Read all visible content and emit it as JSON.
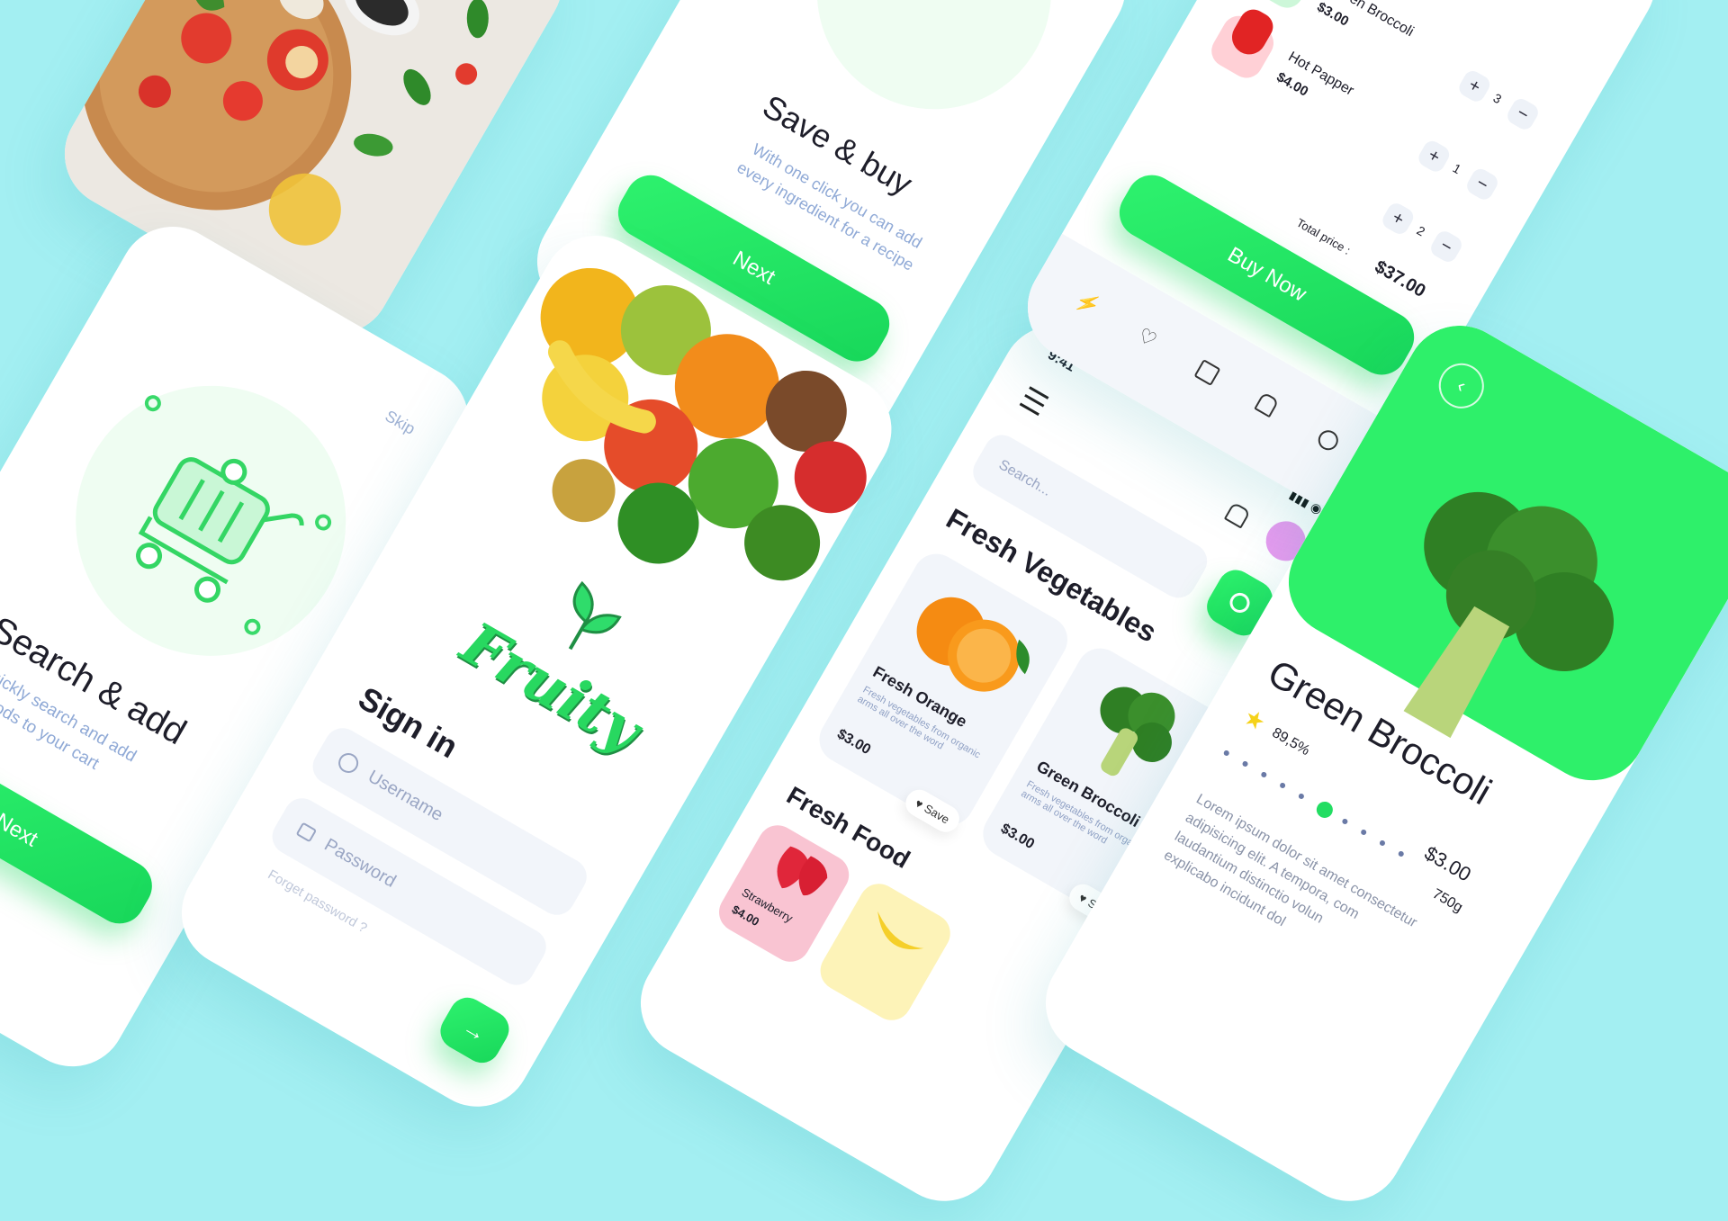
{
  "onboard_search": {
    "skip_label": "Skip",
    "title": "Search & add",
    "subtitle_line1": "Quickly search and add",
    "subtitle_line2": "foods to your cart",
    "next_label": "Next"
  },
  "onboard_save": {
    "title": "Save & buy",
    "subtitle_line1": "With one click you can add",
    "subtitle_line2": "every ingredient for a recipe",
    "next_label": "Next"
  },
  "signin": {
    "logo_text": "Fruity",
    "title": "Sign in",
    "username_placeholder": "Username",
    "password_placeholder": "Password",
    "forgot_label": "Forget password ?"
  },
  "home": {
    "time": "9:41",
    "search_placeholder": "Search...",
    "section_vegetables": "Fresh Vegetables",
    "section_food": "Fresh Food",
    "save_label": "Save",
    "products": [
      {
        "name": "Fresh Orange",
        "desc": "Fresh vegetables from organic arms all over the word",
        "price": "$3.00"
      },
      {
        "name": "Green Broccoli",
        "desc": "Fresh vegetables from organic arms all over the word",
        "price": "$3.00"
      }
    ],
    "food": [
      {
        "name": "Strawberry",
        "price": "$4.00"
      }
    ]
  },
  "cart": {
    "items": [
      {
        "name": "Green Broccoli",
        "price": "$3.00",
        "qty": "3"
      },
      {
        "name": "Hot Papper",
        "price": "$4.00",
        "qty": "1"
      },
      {
        "name": "",
        "price": "",
        "qty": "2"
      }
    ],
    "total_label": "Total price :",
    "total_value": "$37.00",
    "buy_label": "Buy Now",
    "nav_icons": [
      "bolt-icon",
      "heart-icon",
      "bag-icon",
      "bell-icon",
      "user-icon"
    ]
  },
  "detail": {
    "title": "Green Broccoli",
    "rating": "89,5%",
    "price": "$3.00",
    "weight": "750g",
    "desc_line1": "Lorem ipsum dolor sit amet consectetur",
    "desc_line2": "adipisicing elit. A tempora, com",
    "desc_line3": "laudantium distinctio volun",
    "desc_line4": "explicabo incidunt dol"
  },
  "colors": {
    "background": "#a3eff2",
    "accent": "#1fe065",
    "text_dark": "#1e1e2a",
    "text_muted": "#98a8c8"
  }
}
